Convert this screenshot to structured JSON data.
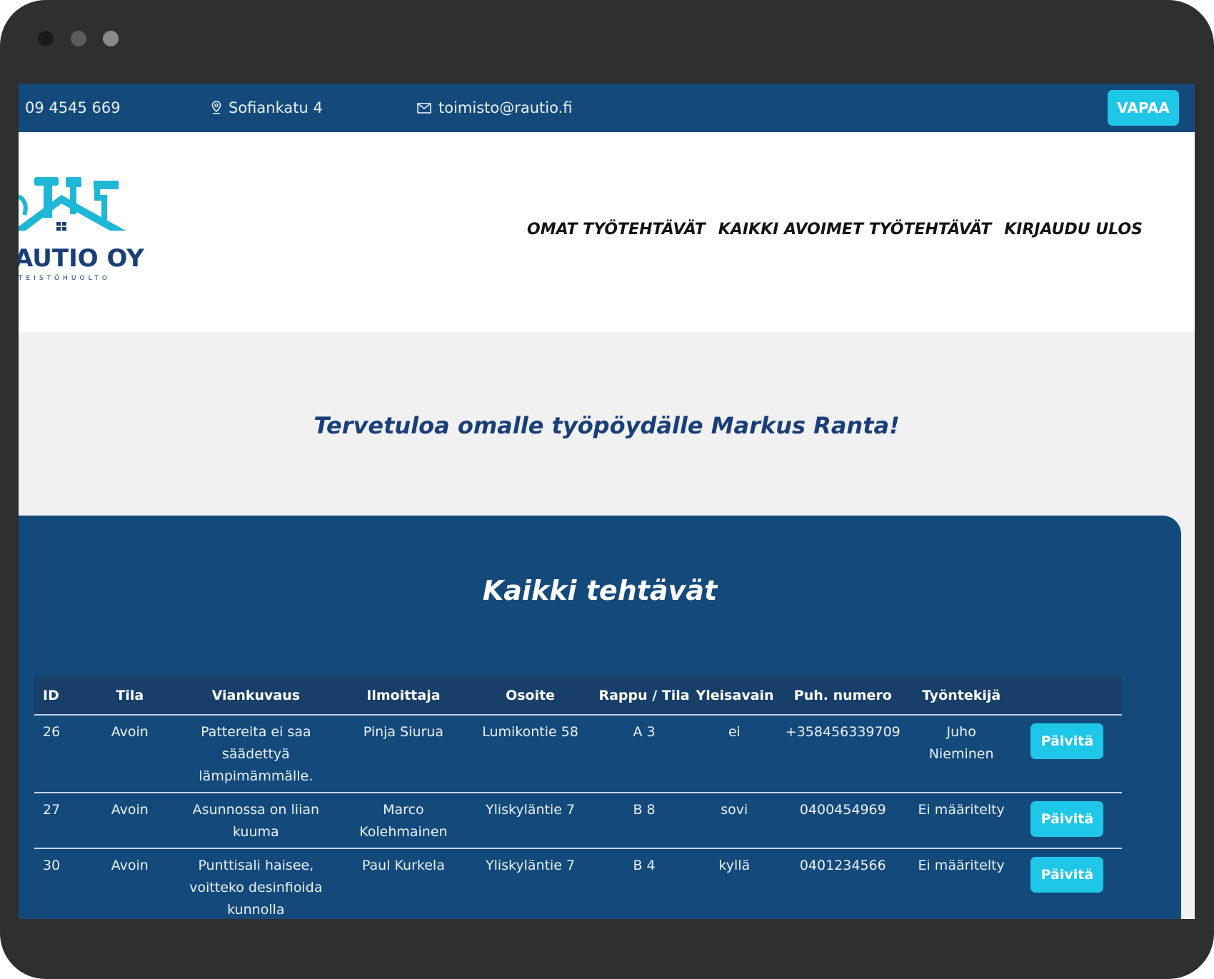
{
  "topbar": {
    "phone": "09 4545 669",
    "address": "Sofiankatu 4",
    "email": "toimisto@rautio.fi",
    "status_button": "VAPAA"
  },
  "logo": {
    "name": "AUTIO OY",
    "subtitle": "TEISTÖHUOLTO"
  },
  "nav": {
    "items": [
      "OMAT TYÖTEHTÄVÄT",
      "KAIKKI AVOIMET TYÖTEHTÄVÄT",
      "KIRJAUDU ULOS"
    ]
  },
  "welcome": "Tervetuloa omalle työpöydälle Markus Ranta!",
  "tasks": {
    "title": "Kaikki tehtävät",
    "columns": [
      "ID",
      "Tila",
      "Viankuvaus",
      "Ilmoittaja",
      "Osoite",
      "Rappu / Tila",
      "Yleisavain",
      "Puh. numero",
      "Työntekijä",
      ""
    ],
    "update_label": "Päivitä",
    "rows": [
      [
        "26",
        "Avoin",
        "Pattereita ei saa säädettyä lämpimämmälle.",
        "Pinja Siurua",
        "Lumikontie 58",
        "A 3",
        "ei",
        "+358456339709",
        "Juho Nieminen"
      ],
      [
        "27",
        "Avoin",
        "Asunnossa on liian kuuma",
        "Marco Kolehmainen",
        "Yliskyläntie 7",
        "B 8",
        "sovi",
        "0400454969",
        "Ei määritelty"
      ],
      [
        "30",
        "Avoin",
        "Punttisali haisee, voitteko desinfioida kunnolla",
        "Paul Kurkela",
        "Yliskyläntie 7",
        "B 4",
        "kyllä",
        "0401234566",
        "Ei määritelty"
      ]
    ]
  },
  "colors": {
    "navy": "#144a7b",
    "accent": "#1ec6e8",
    "heading": "#1a3f78",
    "frame": "#2f2f2f"
  },
  "icons": [
    "location-pin-icon",
    "mail-icon",
    "logo-house-tools-icon"
  ]
}
